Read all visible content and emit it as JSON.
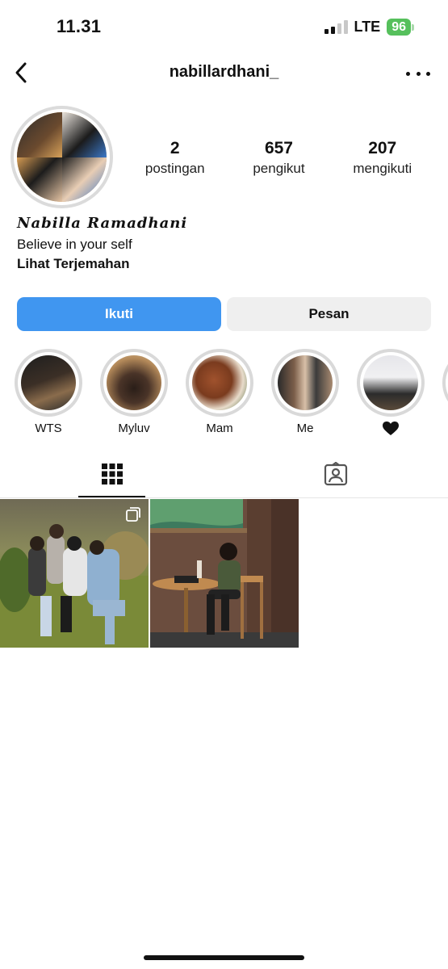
{
  "status_bar": {
    "time": "11.31",
    "network": "LTE",
    "battery": "96"
  },
  "nav": {
    "username": "nabillardhani_"
  },
  "profile": {
    "stats": [
      {
        "value": "2",
        "label": "postingan"
      },
      {
        "value": "657",
        "label": "pengikut"
      },
      {
        "value": "207",
        "label": "mengikuti"
      }
    ],
    "display_name": "Nabilla Ramadhani",
    "bio": "Believe in your self",
    "translate_label": "Lihat Terjemahan"
  },
  "actions": {
    "follow_label": "Ikuti",
    "message_label": "Pesan"
  },
  "highlights": [
    {
      "label": "WTS"
    },
    {
      "label": "Myluv"
    },
    {
      "label": "Mam"
    },
    {
      "label": "Me"
    },
    {
      "label": "",
      "icon": "black-heart-icon"
    }
  ],
  "tabs": [
    {
      "icon": "grid-icon",
      "active": true
    },
    {
      "icon": "tagged-person-icon",
      "active": false
    }
  ],
  "posts": [
    {
      "icon": "multiple-photos-icon"
    },
    {}
  ],
  "colors": {
    "follow_button": "#4096f0",
    "message_button": "#efefef",
    "battery": "#56c05c"
  }
}
